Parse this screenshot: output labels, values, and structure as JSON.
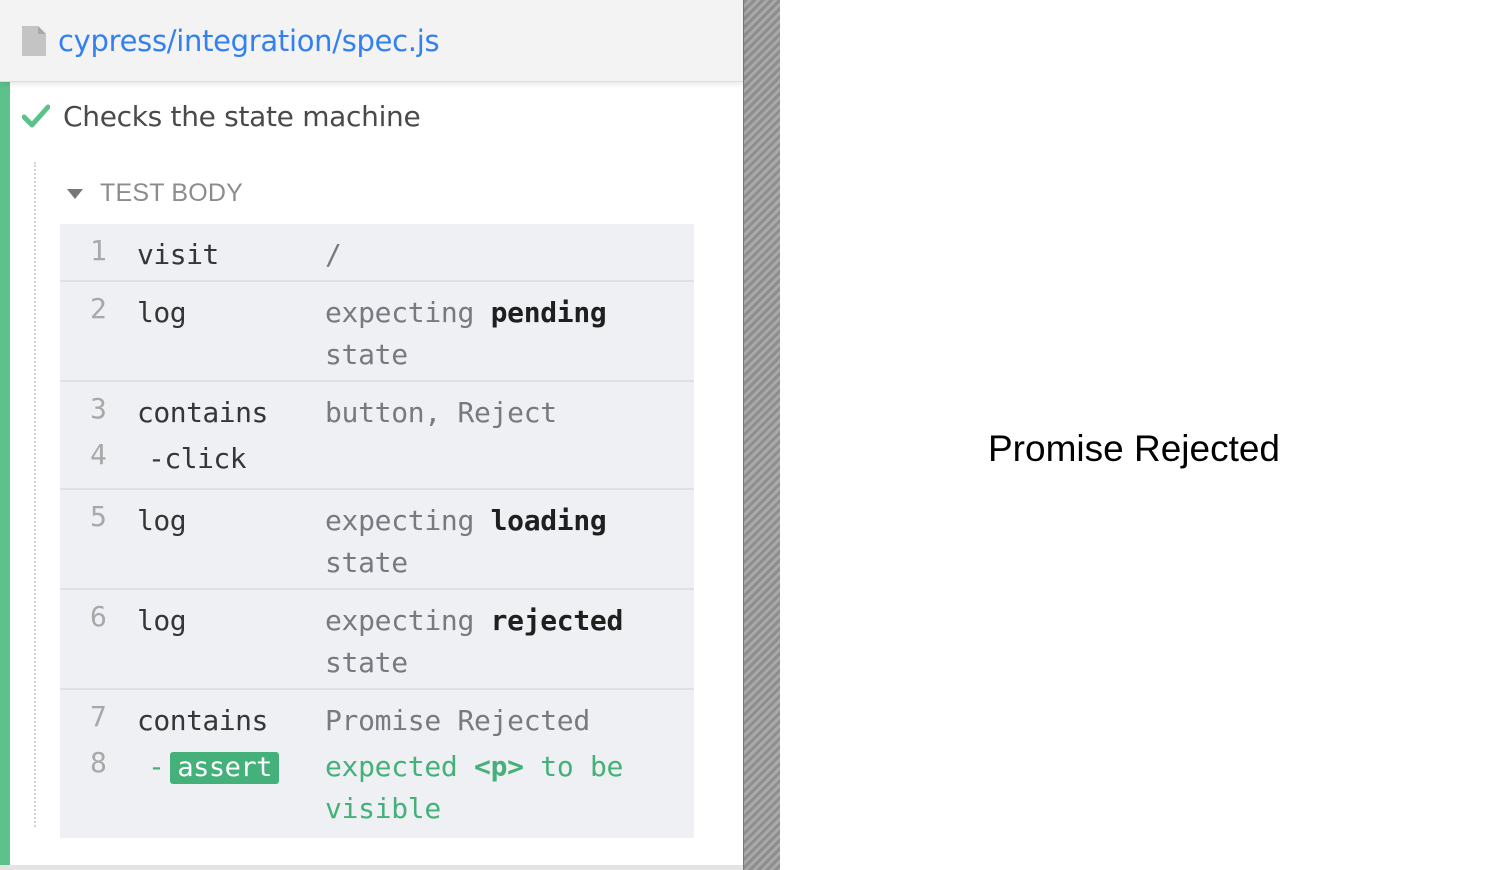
{
  "spec_header": {
    "path": "cypress/integration/spec.js",
    "file_icon": "file-icon"
  },
  "test": {
    "title": "Checks the state machine",
    "status_icon": "check-icon",
    "status_color": "#5cc28a"
  },
  "section": {
    "label": "TEST BODY",
    "icon": "caret-down-icon"
  },
  "commands": [
    {
      "num": "1",
      "name": "visit",
      "message": "/"
    },
    {
      "num": "2",
      "name": "log",
      "msg_prefix": "expecting ",
      "msg_bold": "pending",
      "msg_suffix": " state"
    },
    {
      "num": "3",
      "name": "contains",
      "message": "button, Reject"
    },
    {
      "num": "4",
      "name": "-click"
    },
    {
      "num": "5",
      "name": "log",
      "msg_prefix": "expecting ",
      "msg_bold": "loading",
      "msg_suffix": " state"
    },
    {
      "num": "6",
      "name": "log",
      "msg_prefix": "expecting ",
      "msg_bold": "rejected",
      "msg_suffix": " state"
    },
    {
      "num": "7",
      "name": "contains",
      "message": "Promise Rejected"
    },
    {
      "num": "8",
      "dash": "-",
      "badge": "assert",
      "msg_a": "expected ",
      "msg_tag": "<p>",
      "msg_b": " to be visible"
    }
  ],
  "colors": {
    "accent_blue": "#3380f0",
    "pass_green": "#5cc28a",
    "assert_green": "#44b07a"
  },
  "preview": {
    "text": "Promise Rejected"
  }
}
